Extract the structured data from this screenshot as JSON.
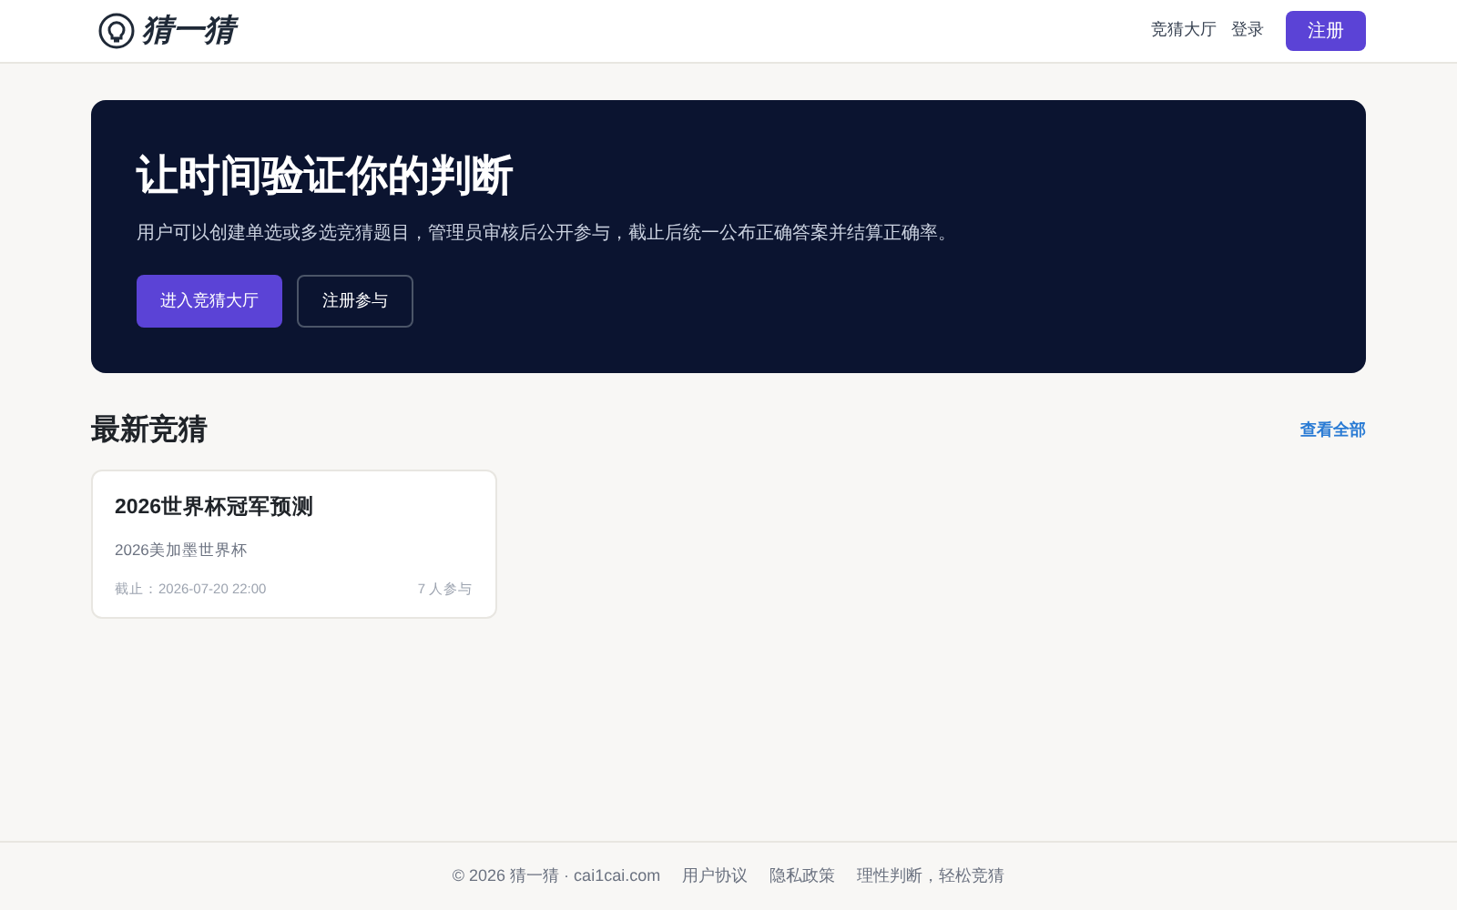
{
  "header": {
    "logo": "猜一猜",
    "nav": [
      "竞猜大厅",
      "登录"
    ],
    "register_button": "注册"
  },
  "hero": {
    "title": "让时间验证你的判断",
    "description": "用户可以创建单选或多选竞猜题目，管理员审核后公开参与，截止后统一公布正确答案并结算正确率。",
    "primary_button": "进入竞猜大厅",
    "secondary_button": "注册参与"
  },
  "latest": {
    "title": "最新竞猜",
    "view_all": "查看全部",
    "cards": [
      {
        "title": "2026世界杯冠军预测",
        "subtitle": "2026美加墨世界杯",
        "deadline": "截止：2026-07-20 22:00",
        "participants": "7 人参与"
      }
    ]
  },
  "footer": {
    "copyright": "© 2026 猜一猜 · cai1cai.com",
    "links": [
      "用户协议",
      "隐私政策",
      "理性判断，轻松竞猜"
    ]
  }
}
